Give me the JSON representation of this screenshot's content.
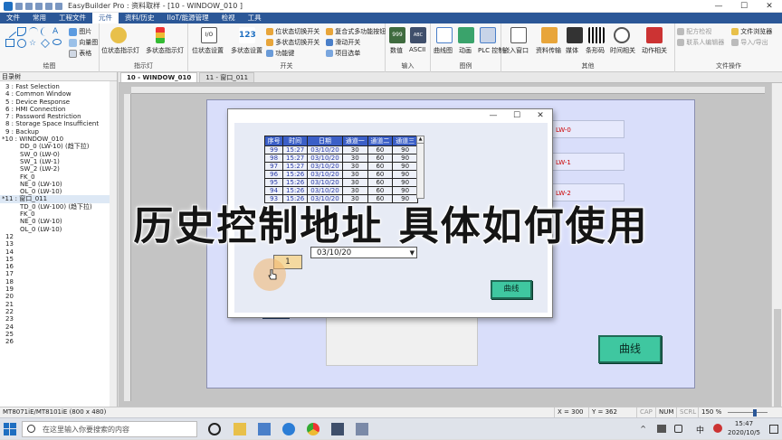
{
  "window": {
    "title": "EasyBuilder Pro : 资料取样 - [10 - WINDOW_010 ]",
    "min": "—",
    "max": "☐",
    "close": "✕"
  },
  "tabs": [
    "文件",
    "常用",
    "工程文件",
    "元件",
    "资料/历史",
    "IIoT/能源管理",
    "检视",
    "工具"
  ],
  "active_tab_index": 3,
  "ribbon": {
    "drawing": {
      "label": "绘图",
      "items": [
        "图片",
        "向量图",
        "表格"
      ]
    },
    "indicator": {
      "label": "指示灯",
      "items": [
        "位状态指示灯",
        "多状态指示灯"
      ]
    },
    "switch": {
      "label": "开关",
      "items": [
        "位状态设置",
        "多状态设置",
        "位状态切换开关",
        "多状态切换开关",
        "功能键",
        "复合式多功能按钮",
        "滑动开关",
        "项目选单"
      ]
    },
    "input": {
      "label": "输入",
      "items": [
        "数值",
        "ASCII"
      ]
    },
    "chart": {
      "label": "图例",
      "items": [
        "曲线图",
        "动画",
        "PLC 控制"
      ]
    },
    "other": {
      "label": "其他",
      "items": [
        "嵌入窗口",
        "资料传输",
        "媒体",
        "条形码",
        "时间相关",
        "动作相关"
      ]
    },
    "file_ops": {
      "label": "文件操作",
      "items": [
        "配方检视",
        "联系人编辑器",
        "文件浏览器",
        "导入/导出"
      ]
    }
  },
  "left_panel": {
    "header": "目录树",
    "items": [
      "3 : Fast Selection",
      "4 : Common Window",
      "5 : Device Response",
      "6 : HMI Connection",
      "7 : Password Restriction",
      "8 : Storage Space Insufficient",
      "9 : Backup",
      "*10 : WINDOW_010",
      "DD_0 (LW-10) (趋下拉)",
      "SW_0 (LW-0)",
      "SW_1 (LW-1)",
      "SW_2 (LW-2)",
      "FK_0",
      "NE_0 (LW-10)",
      "OL_0 (LW-10)",
      "*11 : 窗口_011",
      "TD_0 (LW-100) (趋下拉)",
      "FK_0",
      "NE_0 (LW-10)",
      "OL_0 (LW-10)",
      "12",
      "13",
      "14",
      "15",
      "16",
      "17",
      "18",
      "19",
      "20",
      "21",
      "22",
      "23",
      "24",
      "25",
      "26"
    ],
    "selected_index": 15
  },
  "doc_tabs": [
    "10 - WINDOW_010",
    "11 - 窗口_011"
  ],
  "canvas": {
    "lw_labels": [
      "LW-0",
      "LW-1",
      "LW-2"
    ],
    "curve_button": "曲线"
  },
  "dialog": {
    "min": "—",
    "max": "☐",
    "close": "✕",
    "table": {
      "headers": [
        "序号",
        "时间",
        "日期",
        "通道一",
        "通道二",
        "通道三"
      ],
      "rows": [
        [
          "99",
          "15:27",
          "03/10/20",
          "30",
          "60",
          "90"
        ],
        [
          "98",
          "15:27",
          "03/10/20",
          "30",
          "60",
          "90"
        ],
        [
          "97",
          "15:27",
          "03/10/20",
          "30",
          "60",
          "90"
        ],
        [
          "96",
          "15:26",
          "03/10/20",
          "30",
          "60",
          "90"
        ],
        [
          "95",
          "15:26",
          "03/10/20",
          "30",
          "60",
          "90"
        ],
        [
          "94",
          "15:26",
          "03/10/20",
          "30",
          "60",
          "90"
        ],
        [
          "93",
          "15:26",
          "03/10/20",
          "30",
          "60",
          "90"
        ]
      ]
    },
    "date_select": "03/10/20",
    "number_value": "1",
    "curve_button": "曲线"
  },
  "overlay_caption": "历史控制地址 具体如何使用",
  "status_bar": {
    "model": "MT8071iE/MT8101iE (800 x 480)",
    "x": "X = 300",
    "y": "Y = 362",
    "cap": "CAP",
    "num": "NUM",
    "scrl": "SCRL",
    "zoom": "150 %"
  },
  "taskbar": {
    "search_placeholder": "在这里输入你要搜索的内容",
    "ime": "中",
    "time": "15:47",
    "date": "2020/10/5"
  },
  "colors": {
    "tab_bar": "#2b5797",
    "table_header": "#3b5fc7",
    "screen_bg": "#d9defa",
    "button_green": "#3fc7a0",
    "number_box": "#f4d9a0"
  }
}
